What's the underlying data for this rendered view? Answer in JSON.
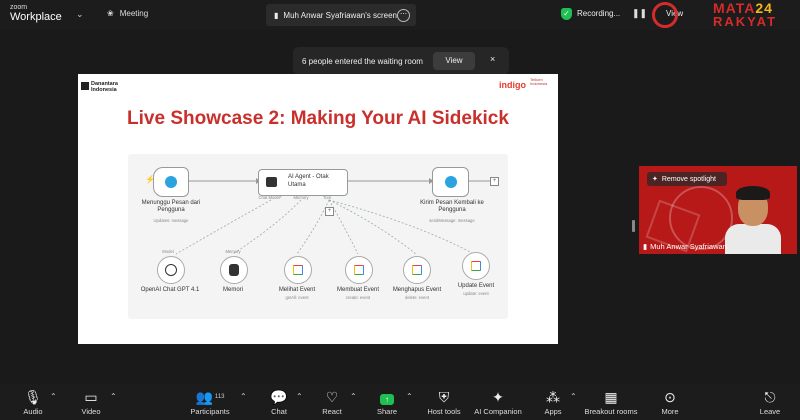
{
  "topbar": {
    "zoom_label_top": "zoom",
    "zoom_label_bottom": "Workplace",
    "meeting_label": "Meeting",
    "screen_share_label": "Muh Anwar Syafriawan's screen",
    "recording_label": "Recording...",
    "view_label": "View",
    "brand_line1": "MATA",
    "brand_num": "24",
    "brand_line2": "RAKYAT"
  },
  "notification": {
    "message": "6 people entered the waiting room",
    "view_label": "View",
    "close_glyph": "×"
  },
  "slide": {
    "org_line1": "Danantara",
    "org_line2": "Indonesia",
    "indigo_label": "indigo",
    "telkom_label": "Telkom Indonesia",
    "title": "Live Showcase 2: Making Your AI Sidekick",
    "diagram": {
      "trigger_title": "Menunggu Pesan dari Pengguna",
      "trigger_sub": "Updates: message",
      "agent_title": "AI Agent - Otak Utama",
      "agent_port_chat": "Chat Model*",
      "agent_port_memory": "Memory",
      "agent_port_tool": "Tool",
      "send_title": "Kirim Pesan Kembali ke Pengguna",
      "send_sub": "sendMessage: message",
      "model_tag": "Model",
      "memory_tag": "Memory",
      "openai_label": "OpenAI Chat GPT 4.1",
      "memori_label": "Memori",
      "tools": [
        {
          "label": "Melihat Event",
          "sub": "getAll: event"
        },
        {
          "label": "Membuat Event",
          "sub": "create: event"
        },
        {
          "label": "Menghapus Event",
          "sub": "delete: event"
        },
        {
          "label": "Update Event",
          "sub": "update: event"
        }
      ]
    }
  },
  "speaker": {
    "remove_spotlight": "Remove spotlight",
    "name": "Muh Anwar Syafriawan"
  },
  "toolbar": {
    "audio": "Audio",
    "video": "Video",
    "participants": "Participants",
    "participants_count": "113",
    "chat": "Chat",
    "react": "React",
    "share": "Share",
    "host_tools": "Host tools",
    "ai_companion": "AI Companion",
    "apps": "Apps",
    "breakout_rooms": "Breakout rooms",
    "more": "More",
    "leave": "Leave"
  },
  "colors": {
    "slide_title": "#c9302c",
    "accent_green": "#1fbf53",
    "brand_red": "#d52b2b",
    "speaker_bg": "#b71818"
  }
}
